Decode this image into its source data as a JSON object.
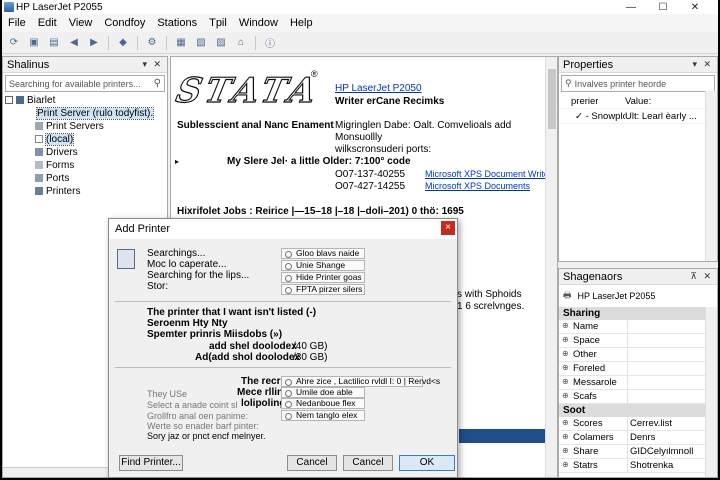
{
  "window": {
    "title": "HP LaserJet P2055"
  },
  "menu": [
    "File",
    "Edit",
    "View",
    "Condfoy",
    "Stations",
    "Tpil",
    "Window",
    "Help"
  ],
  "left_panel": {
    "title": "Shalinus",
    "search_placeholder": "Searching for available printers...",
    "root": "Biarlet",
    "items": [
      "Print Server (rulo todyfist).",
      "Print Servers",
      "(local)",
      "Drivers",
      "Forms",
      "Ports",
      "Printers"
    ]
  },
  "content": {
    "product": "HP LaserJet P2050",
    "subtitle": "Writer erCane Recimks",
    "logo_text": "STATA",
    "reg_mark": "®",
    "status_label": "Sublesscient anal Nanc Enament",
    "status_lines": [
      "Migringlen Dabe: Oalt. Comvelioals add",
      "Monsuollly",
      "wilkscronsuderi ports:"
    ],
    "note": "My Slere Jel· a little Older: 7:100° code",
    "codes": [
      {
        "code": "O07-137-40255",
        "link": "Microsoft XPS Document Writer"
      },
      {
        "code": "O07-427-14255",
        "link": "Microsoft XPS Documents"
      }
    ],
    "jobs_line": "Hixrifolet Jobs : Reirice |—15–18 |–18 |–doli–201)  0  thö:  1695",
    "side_text_1": "s with Sphoids",
    "side_text_2": "1 6 screlvnges.",
    "bluebar_value": "0"
  },
  "properties": {
    "title": "Properties",
    "search_placeholder": "Invalves printer heorde",
    "col_key": "prerier",
    "col_val": "Value:",
    "row_key": "- Snowplcme",
    "row_val": "Ult: Learl èarly ..."
  },
  "shagenaors": {
    "title": "Shagenaors",
    "printer": "HP LaserJet P2055",
    "groups": [
      {
        "name": "Sharing",
        "rows": [
          {
            "k": "Name",
            "v": ""
          },
          {
            "k": "Space",
            "v": ""
          },
          {
            "k": "Other",
            "v": ""
          },
          {
            "k": "Foreled",
            "v": ""
          },
          {
            "k": "Messarole",
            "v": ""
          },
          {
            "k": "Scafs",
            "v": ""
          }
        ]
      },
      {
        "name": "Soot",
        "rows": [
          {
            "k": "Scores",
            "v": "Cerrev.list"
          },
          {
            "k": "Colamers",
            "v": "Denrs"
          },
          {
            "k": "Share",
            "v": "GIDCelyılmnoll"
          },
          {
            "k": "Statrs",
            "v": "Shotrenka"
          }
        ]
      }
    ]
  },
  "dialog": {
    "title": "Add Printer",
    "close": "×",
    "search_lines": [
      "Searchings...",
      "Moc lo caperate...",
      "Searching for the lips...",
      "Stor:"
    ],
    "search_options": [
      "Gloo blavs naide",
      "Unie Shange",
      "Hide Printer goas",
      "FPTA pirzer silers"
    ],
    "not_listed": "The printer that I want isn't listed (-)",
    "line2": "Seroenm Hty Nty",
    "line3": "Spemter prinris Miisdobs (»)",
    "disk1_label": "add shel doolodex",
    "disk1_value": "/40 GB)",
    "disk2_label": "Ad(add shol doolodex",
    "disk2_value": "/30 GB)",
    "recip_label": "The recrip",
    "recip_option": "Ahre zice ,  Lactilico rvldl   I:  0 | Rervd<s",
    "mece_label": "Mece rlling",
    "mece_option": "Umile doe able",
    "lolipoling_label": "lolipoling",
    "lolipoling_option": "Nedanboue flex",
    "option4": "Nem tanglo elex",
    "gray1": "They USe",
    "gray2": "Select a anade coint sl",
    "gray3": "Grollfro anal oen panime:",
    "gray4": "Werte so enader barf pinter:",
    "gray5": "Sory jaz or pnct encf melnyer.",
    "find_btn": "Find Printer...",
    "cancel1": "Cancel",
    "cancel2": "Cancel",
    "ok": "OK"
  }
}
